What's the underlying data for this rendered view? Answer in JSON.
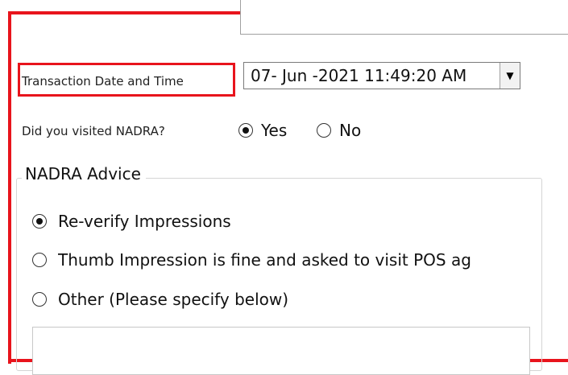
{
  "colors": {
    "annotation_red": "#e8141c",
    "text": "#1a1a1a",
    "border": "#a0a0a0"
  },
  "transaction": {
    "label": "Transaction Date and Time",
    "value": "07- Jun -2021 11:49:20 AM",
    "dropdown_icon": "chevron-down-icon"
  },
  "visited": {
    "question": "Did you visited NADRA?",
    "options": [
      {
        "label": "Yes",
        "selected": true
      },
      {
        "label": "No",
        "selected": false
      }
    ]
  },
  "advice": {
    "title": "NADRA Advice",
    "options": [
      {
        "label": "Re-verify Impressions",
        "selected": true
      },
      {
        "label": "Thumb Impression is fine and asked to visit POS ag",
        "selected": false
      },
      {
        "label": "Other (Please specify below)",
        "selected": false
      }
    ],
    "other_text": ""
  }
}
